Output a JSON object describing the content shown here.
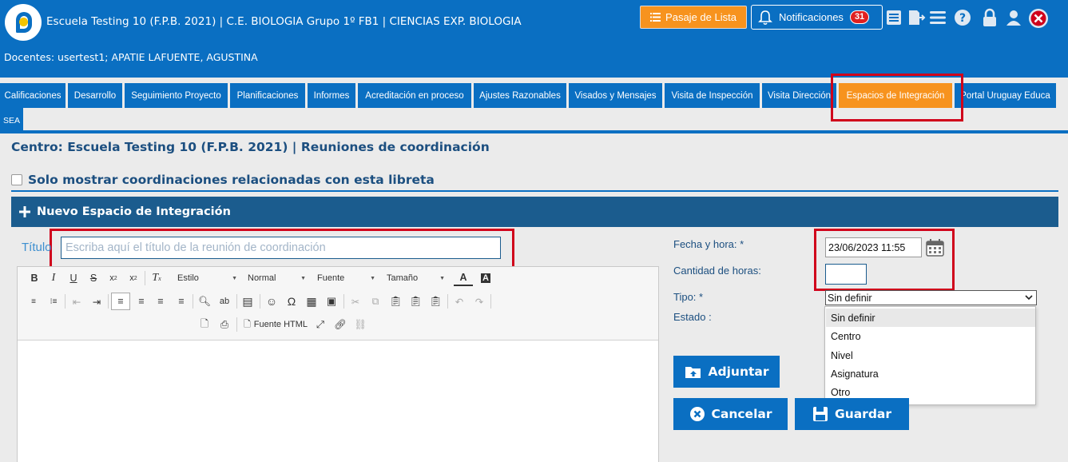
{
  "header": {
    "app_title": "Escuela Testing 10 (F.P.B. 2021) | C.E. BIOLOGIA Grupo 1º FB1 | CIENCIAS EXP. BIOLOGIA",
    "docentes": "Docentes: usertest1; APATIE LAFUENTE, AGUSTINA",
    "pasaje_label": "Pasaje de Lista",
    "notif_label": "Notificaciones",
    "notif_count": "31",
    "icons": [
      "list-book-icon",
      "export-icon",
      "menu-icon",
      "help-icon",
      "lock-icon",
      "user-icon",
      "close-icon"
    ]
  },
  "colors": {
    "primary": "#0a6fc2",
    "dark_blue": "#1b5c8e",
    "orange": "#f7931e",
    "highlight_red": "#d0021b",
    "text_blue": "#1c4f80"
  },
  "tabs": [
    {
      "label": "Calificaciones"
    },
    {
      "label": "Desarrollo"
    },
    {
      "label": "Seguimiento Proyecto"
    },
    {
      "label": "Planificaciones"
    },
    {
      "label": "Informes"
    },
    {
      "label": "Acreditación en proceso"
    },
    {
      "label": "Ajustes Razonables"
    },
    {
      "label": "Visados y Mensajes"
    },
    {
      "label": "Visita de Inspección"
    },
    {
      "label": "Visita Dirección"
    },
    {
      "label": "Espacios de Integración",
      "active": true
    },
    {
      "label": "Portal Uruguay Educa"
    },
    {
      "label": "SEA"
    }
  ],
  "page": {
    "heading": "Centro: Escuela Testing 10 (F.P.B. 2021) | Reuniones de coordinación",
    "filter_label": "Solo mostrar coordinaciones relacionadas con esta libreta",
    "section_title": "Nuevo Espacio de Integración"
  },
  "form": {
    "titulo_label": "Título",
    "titulo_placeholder": "Escriba aquí el título de la reunión de coordinación",
    "titulo_value": "",
    "fecha_label": "Fecha y hora: *",
    "fecha_value": "23/06/2023 11:55",
    "horas_label": "Cantidad de horas:",
    "horas_value": "",
    "tipo_label": "Tipo: *",
    "tipo_value": "Sin definir",
    "tipo_options": [
      "Sin definir",
      "Centro",
      "Nivel",
      "Asignatura",
      "Otro"
    ],
    "estado_label": "Estado :"
  },
  "editor": {
    "estilo": "Estilo",
    "normal": "Normal",
    "fuente": "Fuente",
    "tamano": "Tamaño",
    "fuente_html": "Fuente HTML"
  },
  "buttons": {
    "adjuntar": "Adjuntar",
    "cancelar": "Cancelar",
    "guardar": "Guardar"
  }
}
